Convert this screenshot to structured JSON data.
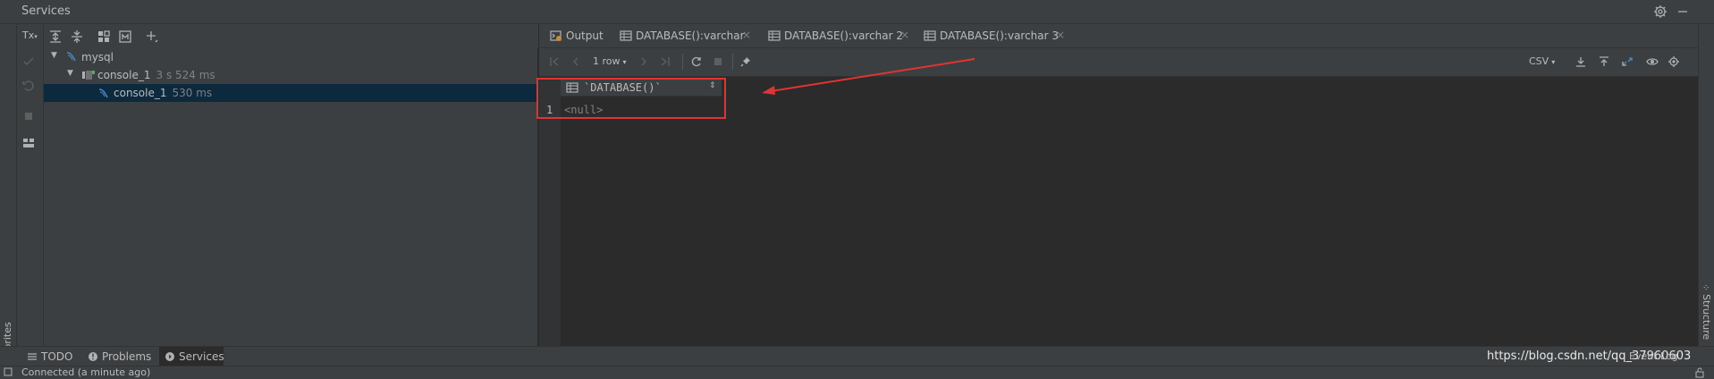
{
  "window": {
    "title": "Services"
  },
  "tool_column": {
    "tx_label": "Tx",
    "icons": [
      "tx-icon",
      "check-icon",
      "undo-icon",
      "stop-icon",
      "layout-icon"
    ]
  },
  "services_toolbar": {
    "icons": [
      "expand-all-icon",
      "collapse-all-icon",
      "group-by-icon",
      "filter-icon",
      "add-service-icon"
    ]
  },
  "tree": {
    "items": [
      {
        "label": "mysql",
        "time": "",
        "level": 0,
        "icon": "mysql-icon",
        "expanded": true,
        "selected": false
      },
      {
        "label": "console_1",
        "time": "3 s 524 ms",
        "level": 1,
        "icon": "console-icon",
        "expanded": true,
        "selected": false
      },
      {
        "label": "console_1",
        "time": "530 ms",
        "level": 2,
        "icon": "session-icon",
        "expanded": false,
        "selected": true
      }
    ]
  },
  "tabs": [
    {
      "label": "Output",
      "icon": "output-icon",
      "closable": false,
      "active": false
    },
    {
      "label": "DATABASE():varchar",
      "icon": "table-icon",
      "closable": true,
      "active": false
    },
    {
      "label": "DATABASE():varchar 2",
      "icon": "table-icon",
      "closable": true,
      "active": false
    },
    {
      "label": "DATABASE():varchar 3",
      "icon": "table-icon",
      "closable": true,
      "active": true
    }
  ],
  "result_toolbar": {
    "rows_label": "1 row",
    "export_format": "CSV"
  },
  "grid": {
    "columns": [
      "`DATABASE()`"
    ],
    "rows": [
      {
        "num": "1",
        "values": [
          "<null>"
        ]
      }
    ]
  },
  "side_panels": {
    "favorites": "Favorites",
    "structure": "Structure"
  },
  "bottom_tabs": [
    {
      "label": "TODO",
      "icon": "todo-icon",
      "active": false
    },
    {
      "label": "Problems",
      "icon": "problems-icon",
      "active": false
    },
    {
      "label": "Services",
      "icon": "services-icon",
      "active": true
    }
  ],
  "status": {
    "text": "Connected (a minute ago)",
    "watermark": "https://blog.csdn.net/qq_37960603",
    "event_log": "Event Log"
  },
  "colors": {
    "annotation": "#e03434",
    "accent": "#4a88c7",
    "background": "#2b2b2b",
    "panel": "#3c3f41"
  }
}
